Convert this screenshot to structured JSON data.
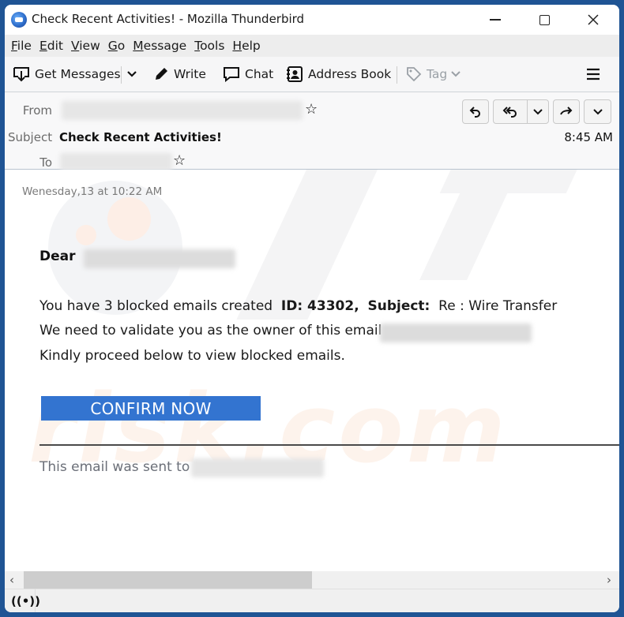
{
  "window": {
    "title": "Check Recent Activities! - Mozilla Thunderbird",
    "app_icon": "thunderbird-icon",
    "controls": [
      "minimize",
      "maximize",
      "close"
    ]
  },
  "menubar": {
    "items": [
      {
        "label": "File",
        "accel": "F"
      },
      {
        "label": "Edit",
        "accel": "E"
      },
      {
        "label": "View",
        "accel": "V"
      },
      {
        "label": "Go",
        "accel": "G"
      },
      {
        "label": "Message",
        "accel": "M"
      },
      {
        "label": "Tools",
        "accel": "T"
      },
      {
        "label": "Help",
        "accel": "H"
      }
    ]
  },
  "toolbar": {
    "get_messages": "Get Messages",
    "write": "Write",
    "chat": "Chat",
    "address_book": "Address Book",
    "tag": "Tag",
    "menu_icon": "hamburger-menu-icon"
  },
  "header": {
    "from_label": "From",
    "subject_label": "Subject",
    "to_label": "To",
    "subject": "Check Recent Activities!",
    "time": "8:45 AM",
    "actions": [
      "reply",
      "reply-all",
      "reply-all-dropdown",
      "forward",
      "more"
    ]
  },
  "body": {
    "date": "Wenesday,13 at 10:22 AM",
    "greeting": "Dear",
    "line1_prefix": "You have 3 blocked emails created",
    "line1_id_label": "ID: 43302,",
    "line1_subject_label": "Subject:",
    "line1_subject_value": "Re : Wire Transfer",
    "line2": "We need to validate you as the owner of this email",
    "line3": "Kindly proceed below to view blocked emails.",
    "cta": "CONFIRM NOW",
    "footer": "This email was sent to",
    "watermark": "risk.com",
    "cta_color": "#3374d0"
  },
  "scrollbar": {
    "left_arrow": "‹",
    "right_arrow": "›",
    "position_fraction": 0.0,
    "visible_fraction": 0.5
  },
  "statusbar": {
    "icon": "online-status-icon"
  }
}
